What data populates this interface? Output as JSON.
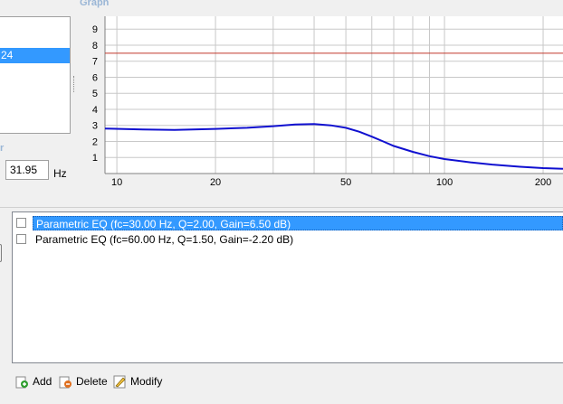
{
  "graph": {
    "title": "Graph",
    "y_ticks": [
      "9",
      "8",
      "7",
      "6",
      "5",
      "4",
      "3",
      "2",
      "1"
    ],
    "x_ticks": [
      "10",
      "20",
      "50",
      "100",
      "200"
    ],
    "reference_line_color": "#c0392b",
    "curve_color": "#1010d0"
  },
  "left_panel": {
    "selected_item": "24",
    "section_label": "r",
    "frequency_value": "31.95",
    "frequency_unit": "Hz"
  },
  "eq_list": {
    "items": [
      {
        "label": "Parametric EQ (fc=30.00 Hz, Q=2.00, Gain=6.50 dB)",
        "checked": false,
        "selected": true
      },
      {
        "label": "Parametric EQ (fc=60.00 Hz, Q=1.50, Gain=-2.20 dB)",
        "checked": false,
        "selected": false
      }
    ]
  },
  "toolbar": {
    "add_label": "Add",
    "delete_label": "Delete",
    "modify_label": "Modify"
  }
}
